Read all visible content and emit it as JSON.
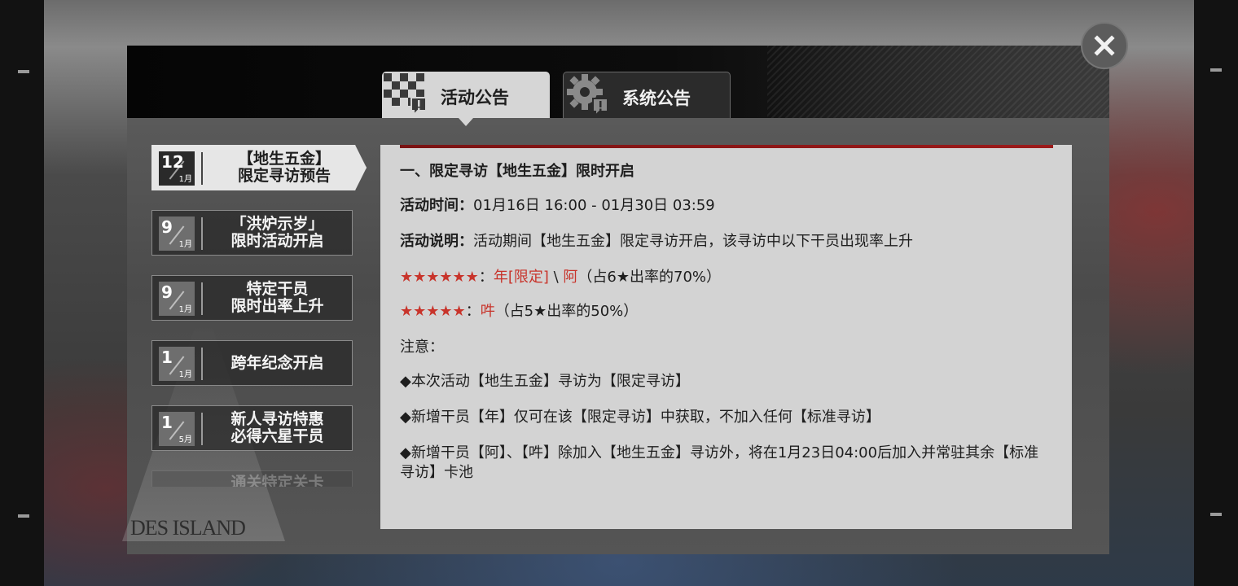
{
  "tabs": {
    "active_label": "活动公告",
    "inactive_label": "系统公告"
  },
  "sidebar": {
    "items": [
      {
        "day": "12",
        "month": "1月",
        "title": "【地生五金】\n限定寻访预告"
      },
      {
        "day": "9",
        "month": "1月",
        "title": "「洪炉示岁」\n限时活动开启"
      },
      {
        "day": "9",
        "month": "1月",
        "title": "特定干员\n限时出率上升"
      },
      {
        "day": "1",
        "month": "1月",
        "title": "跨年纪念开启"
      },
      {
        "day": "1",
        "month": "5月",
        "title": "新人寻访特惠\n必得六星干员"
      },
      {
        "day": "",
        "month": "",
        "title": "通关特定关卡"
      }
    ],
    "logo_text": "RHODES ISLAND"
  },
  "content": {
    "heading": "一、限定寻访【地生五金】限时开启",
    "time_label": "活动时间：",
    "time_value": "01月16日 16:00 - 01月30日 03:59",
    "desc_label": "活动说明：",
    "desc_value": "活动期间【地生五金】限定寻访开启，该寻访中以下干员出现率上升",
    "six_star": "★★★★★★",
    "six_star_colon": "：",
    "six_star_op1": "年[限定]",
    "six_star_sep": "\\",
    "six_star_op2": "阿",
    "six_star_rate": "（占6★出率的70%）",
    "five_star": "★★★★★",
    "five_star_colon": "：",
    "five_star_op": "吽",
    "five_star_rate": "（占5★出率的50%）",
    "notice_label": "注意：",
    "notes": [
      "◆本次活动【地生五金】寻访为【限定寻访】",
      "◆新增干员【年】仅可在该【限定寻访】中获取，不加入任何【标准寻访】",
      "◆新增干员【阿】、【吽】除加入【地生五金】寻访外，将在1月23日04:00后加入并常驻其余【标准寻访】卡池"
    ]
  },
  "colors": {
    "accent_red": "#c8342b",
    "topbar_red": "#8a1616",
    "panel_bg": "#d3d3d3"
  },
  "icons": {
    "close": "close-icon",
    "activity_tab": "checkered-flag-icon",
    "system_tab": "gear-alert-icon"
  }
}
